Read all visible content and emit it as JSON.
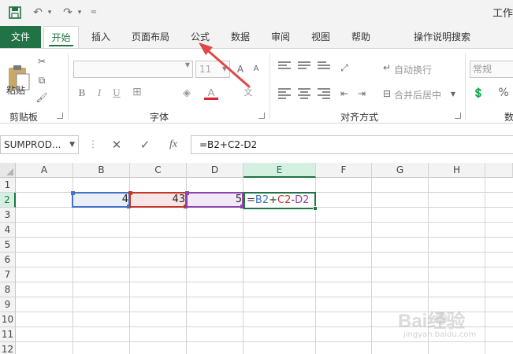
{
  "qat": {
    "save_icon": "save-icon",
    "undo_icon": "undo-icon",
    "redo_icon": "redo-icon",
    "customize_icon": "customize-icon",
    "title": "工作"
  },
  "tabs": [
    {
      "label": "文件"
    },
    {
      "label": "开始"
    },
    {
      "label": "插入"
    },
    {
      "label": "页面布局"
    },
    {
      "label": "公式"
    },
    {
      "label": "数据"
    },
    {
      "label": "审阅"
    },
    {
      "label": "视图"
    },
    {
      "label": "帮助"
    },
    {
      "label": "操作说明搜索"
    }
  ],
  "ribbon": {
    "clipboard": {
      "paste_label": "粘贴",
      "group_label": "剪贴板"
    },
    "font": {
      "font_name": "",
      "font_size": "11",
      "group_label": "字体"
    },
    "alignment": {
      "wrap_label": "自动换行",
      "merge_label": "合并后居中",
      "group_label": "对齐方式"
    },
    "number": {
      "format": "常规",
      "percent": "%",
      "group_label": "数"
    }
  },
  "formula_bar": {
    "name_box": "SUMPROD...",
    "cancel": "✕",
    "enter": "✓",
    "fx": "fx",
    "formula": "=B2+C2-D2"
  },
  "sheet": {
    "columns": [
      "A",
      "B",
      "C",
      "D",
      "E",
      "F",
      "G",
      "H"
    ],
    "selected_column": "E",
    "rows": [
      "1",
      "2",
      "3",
      "4",
      "5",
      "6",
      "7",
      "8",
      "9",
      "10",
      "11",
      "12"
    ],
    "selected_row": "2",
    "cells": {
      "B2": "4",
      "C2": "43",
      "D2": "5"
    },
    "formula_parts": [
      {
        "text": "=",
        "color": "#333333"
      },
      {
        "text": "B2",
        "color": "#4472c4"
      },
      {
        "text": "+",
        "color": "#333333"
      },
      {
        "text": "C2",
        "color": "#c0392b"
      },
      {
        "text": "-",
        "color": "#333333"
      },
      {
        "text": "D2",
        "color": "#8e44ad"
      }
    ]
  },
  "colors": {
    "accent": "#217346",
    "ref_b": "#4472c4",
    "ref_c": "#c0392b",
    "ref_d": "#8e44ad",
    "annotation_arrow": "#e04848"
  },
  "watermark": {
    "text": "Bai经验",
    "sub": "jingyan.baidu.com"
  }
}
